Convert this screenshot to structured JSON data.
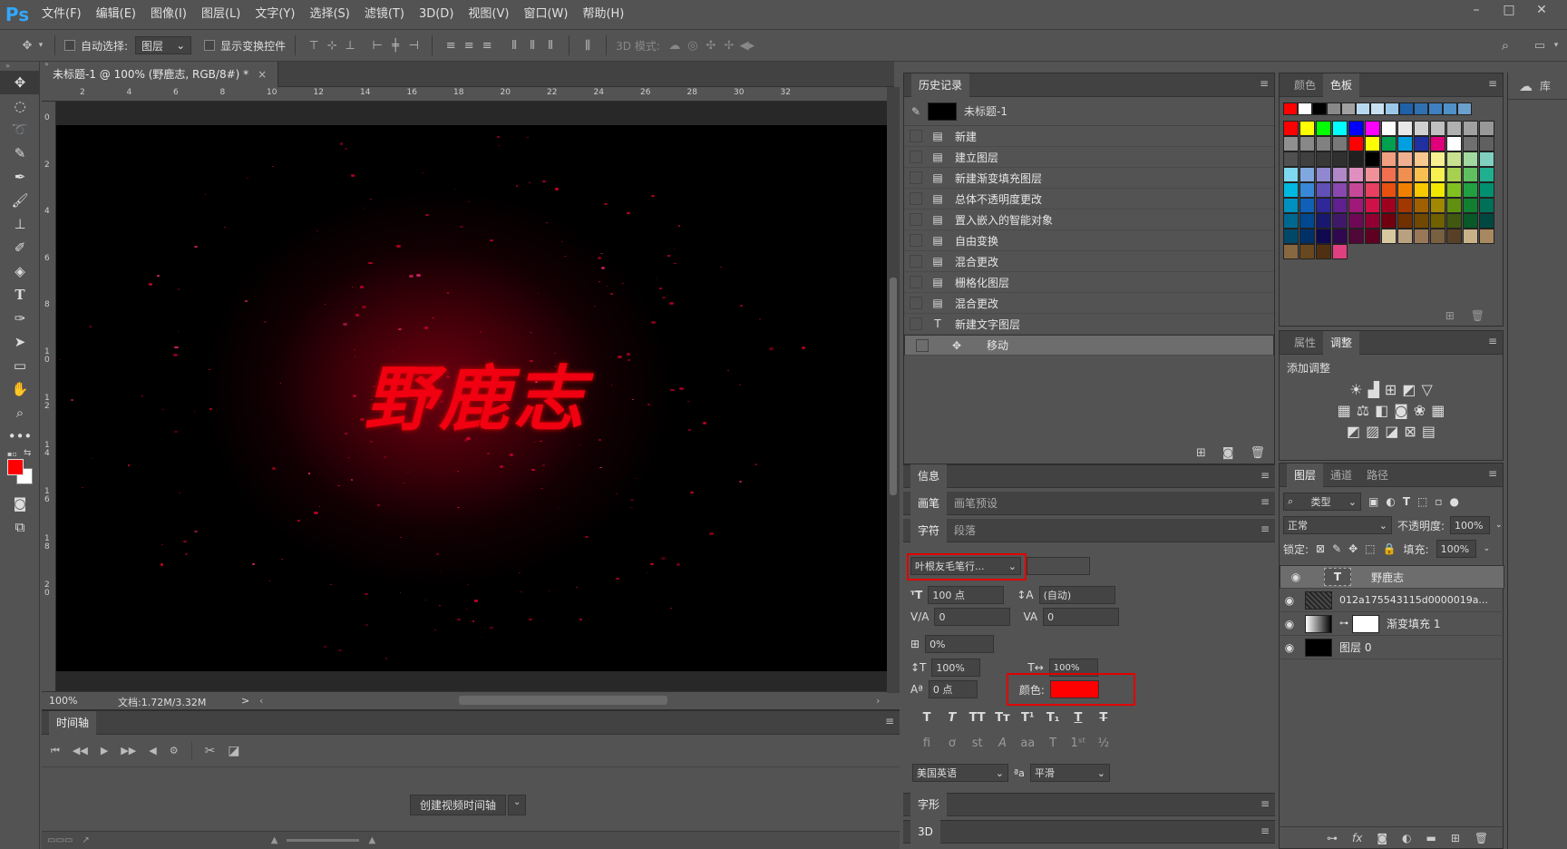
{
  "app": {
    "logo": "Ps"
  },
  "menu": [
    "文件(F)",
    "编辑(E)",
    "图像(I)",
    "图层(L)",
    "文字(Y)",
    "选择(S)",
    "滤镜(T)",
    "3D(D)",
    "视图(V)",
    "窗口(W)",
    "帮助(H)"
  ],
  "options": {
    "auto_select_label": "自动选择:",
    "auto_select_value": "图层",
    "show_transform_label": "显示变换控件",
    "mode3d_label": "3D 模式:"
  },
  "document": {
    "tab_title": "未标题-1 @ 100% (野鹿志, RGB/8#) *",
    "canvas_text": "野鹿志",
    "zoom": "100%",
    "doc_size": "文档:1.72M/3.32M",
    "ruler_h": [
      "2",
      "4",
      "6",
      "8",
      "10",
      "12",
      "14",
      "16",
      "18",
      "20",
      "22",
      "24",
      "26",
      "28",
      "30",
      "32"
    ],
    "ruler_v": [
      "0",
      "2",
      "4",
      "6",
      "8",
      "1\n0",
      "1\n2",
      "1\n4",
      "1\n6",
      "1\n8",
      "2\n0"
    ]
  },
  "timeline": {
    "title": "时间轴",
    "create_button": "创建视频时间轴"
  },
  "history": {
    "title": "历史记录",
    "snapshot": "未标题-1",
    "items": [
      "新建",
      "建立图层",
      "新建渐变填充图层",
      "总体不透明度更改",
      "置入嵌入的智能对象",
      "自由变换",
      "混合更改",
      "栅格化图层",
      "混合更改",
      "新建文字图层",
      "移动"
    ]
  },
  "info_panel": {
    "title": "信息"
  },
  "brush_panel": {
    "tab1": "画笔",
    "tab2": "画笔预设"
  },
  "char_panel": {
    "tab1": "字符",
    "tab2": "段落",
    "font_family": "叶根友毛笔行...",
    "font_size": "100 点",
    "leading": "(自动)",
    "kerning": "0",
    "tracking": "0",
    "scale_v_pct": "0%",
    "scale_h": "100%",
    "scale_v": "100%",
    "baseline": "0 点",
    "color_label": "颜色:",
    "color": "#ff0000",
    "language": "美国英语",
    "aa_label": "ªa",
    "antialias": "平滑"
  },
  "glyph_panel": {
    "title": "字形"
  },
  "panel3d": {
    "title": "3D"
  },
  "color_panel": {
    "tab1": "颜色",
    "tab2": "色板"
  },
  "adj_panel": {
    "tab1": "属性",
    "tab2": "调整",
    "add_label": "添加调整"
  },
  "layers_panel": {
    "tab1": "图层",
    "tab2": "通道",
    "tab3": "路径",
    "filter": "类型",
    "blend": "正常",
    "opacity_label": "不透明度:",
    "opacity": "100%",
    "lock_label": "锁定:",
    "fill_label": "填充:",
    "fill": "100%",
    "layers": [
      {
        "name": "野鹿志",
        "kind": "text"
      },
      {
        "name": "012a175543115d0000019a...",
        "kind": "image"
      },
      {
        "name": "渐变填充 1",
        "kind": "gradient"
      },
      {
        "name": "图层 0",
        "kind": "fill"
      }
    ]
  },
  "lib_panel": {
    "label": "库"
  },
  "swatches_top": [
    "#ff0000",
    "#ffffff",
    "#000000",
    "#888888",
    "#a0a0a0",
    "#b8d8f0",
    "#c8e0f0",
    "#9cc8e8",
    "#2060a8",
    "#3070b0",
    "#4080c0",
    "#5090c8",
    "#6ca0cc"
  ],
  "swatches": [
    "#ff0000",
    "#ffff00",
    "#00ff00",
    "#00ffff",
    "#0000ff",
    "#ff00ff",
    "#ffffff",
    "#e8e8e8",
    "#d0d0d0",
    "#c0c0c0",
    "#b0b0b0",
    "#a0a0a0",
    "#989898",
    "#909090",
    "#888888",
    "#808080",
    "#787878",
    "#ff0000",
    "#ffff00",
    "#00a050",
    "#00a0e0",
    "#2030a0",
    "#e0007a",
    "#ffffff",
    "#707070",
    "#606060",
    "#505050",
    "#404040",
    "#383838",
    "#303030",
    "#202020",
    "#000000",
    "#f0a080",
    "#f0b090",
    "#f8c890",
    "#f8f090",
    "#c8e090",
    "#a0d8a0",
    "#80d0c0",
    "#80d8f0",
    "#80a8e0",
    "#9088d0",
    "#b088c8",
    "#e090c0",
    "#f09098",
    "#f07050",
    "#f09050",
    "#f8c050",
    "#f8f050",
    "#a8d050",
    "#60c060",
    "#20b090",
    "#00b8e0",
    "#3888d8",
    "#6050b8",
    "#8848b0",
    "#c84898",
    "#e84060",
    "#e85010",
    "#f08000",
    "#f8c800",
    "#f0e800",
    "#80c020",
    "#20a040",
    "#009070",
    "#0090c0",
    "#1060b8",
    "#302898",
    "#602090",
    "#a01878",
    "#d01048",
    "#a00020",
    "#a03800",
    "#a06000",
    "#a08800",
    "#609010",
    "#108030",
    "#007058",
    "#006890",
    "#004890",
    "#181870",
    "#401868",
    "#700858",
    "#900030",
    "#700010",
    "#703000",
    "#704800",
    "#706000",
    "#405810",
    "#085828",
    "#004840",
    "#004868",
    "#003068",
    "#100850",
    "#300850",
    "#500838",
    "#600020",
    "#d8c8a0",
    "#b8a080",
    "#987858",
    "#786040",
    "#584028",
    "#c8b088",
    "#a88860",
    "#886840",
    "#684820",
    "#503010",
    "#e04080"
  ],
  "status": {
    "arrow": ">"
  }
}
